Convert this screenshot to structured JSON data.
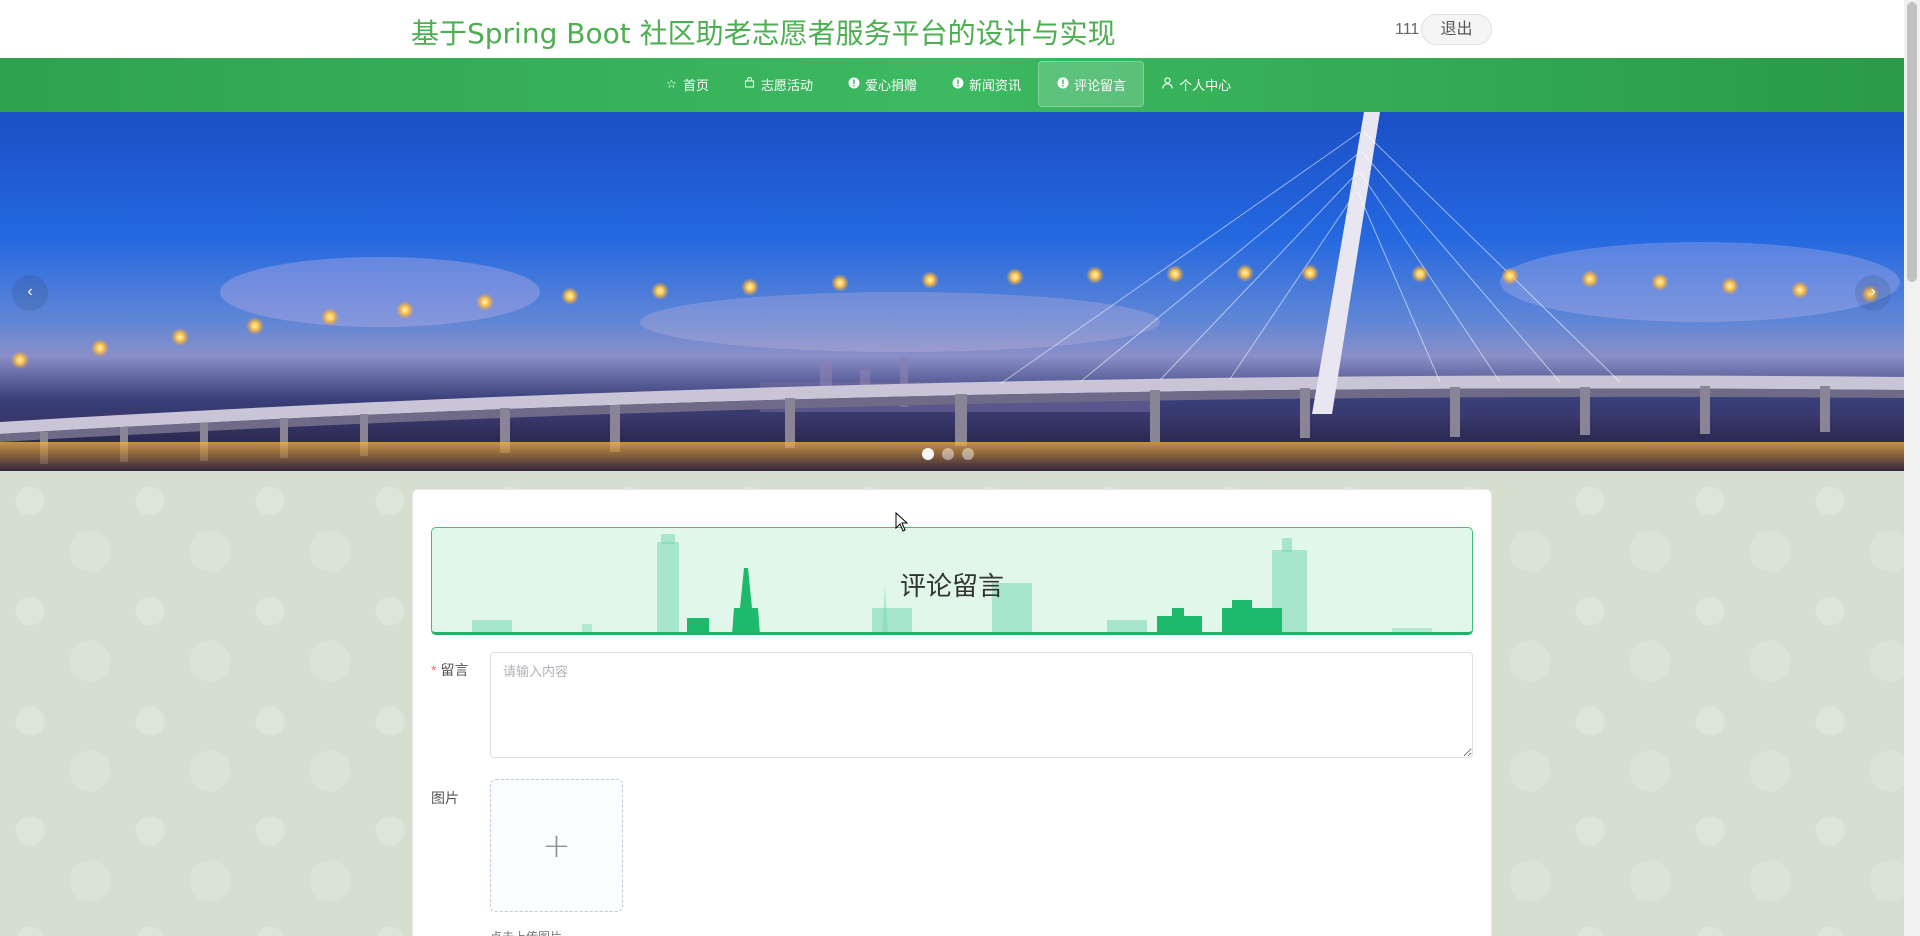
{
  "header": {
    "site_title": "基于Spring Boot 社区助老志愿者服务平台的设计与实现",
    "user_name": "111",
    "logout_label": "退出"
  },
  "nav": {
    "items": [
      {
        "label": "首页",
        "icon": "star-icon"
      },
      {
        "label": "志愿活动",
        "icon": "bag-icon"
      },
      {
        "label": "爱心捐赠",
        "icon": "info-circle-icon"
      },
      {
        "label": "新闻资讯",
        "icon": "info-circle-icon"
      },
      {
        "label": "评论留言",
        "icon": "info-circle-icon",
        "active": true
      },
      {
        "label": "个人中心",
        "icon": "user-icon"
      }
    ]
  },
  "banner": {
    "prev_arrow": "‹",
    "next_arrow": "›",
    "slide_count": 3,
    "active_slide": 1
  },
  "form": {
    "section_title": "评论留言",
    "message_label": "留言",
    "message_required_mark": "*",
    "message_placeholder": "请输入内容",
    "message_value": "",
    "image_label": "图片",
    "upload_plus": "+",
    "upload_tip": "点击上传图片"
  },
  "colors": {
    "brand_green": "#4caf50",
    "nav_green": "#34ad58",
    "header_border": "#22b36a"
  }
}
